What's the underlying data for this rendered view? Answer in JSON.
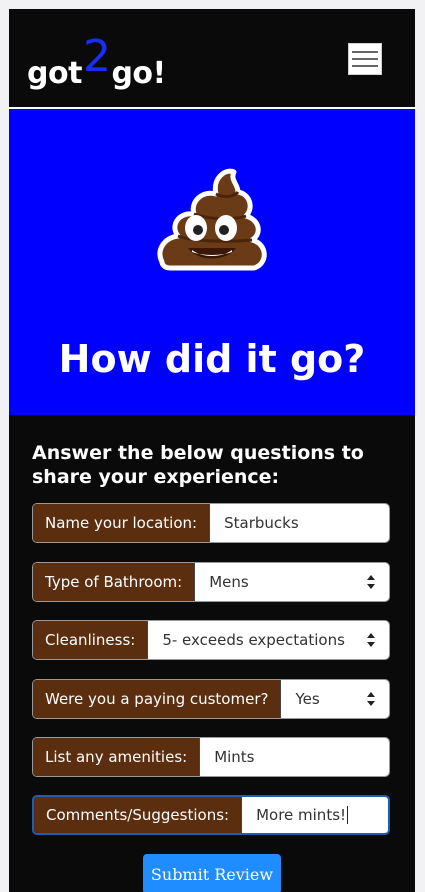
{
  "header": {
    "brand_prefix": "got",
    "brand_number": "2",
    "brand_suffix": "go!",
    "menu_icon": "hamburger-menu-icon"
  },
  "hero": {
    "emoji_icon": "pile-of-poo-emoji",
    "title": "How did it go?"
  },
  "form": {
    "intro": "Answer the below questions to share your experience:",
    "fields": [
      {
        "label": "Name your location:",
        "value": "Starbucks",
        "type": "text"
      },
      {
        "label": "Type of Bathroom:",
        "value": "Mens",
        "type": "select"
      },
      {
        "label": "Cleanliness:",
        "value": "5- exceeds expectations",
        "type": "select"
      },
      {
        "label": "Were you a paying customer?",
        "value": "Yes",
        "type": "select"
      },
      {
        "label": "List any amenities:",
        "value": "Mints",
        "type": "text"
      },
      {
        "label": "Comments/Suggestions:",
        "value": "More mints!",
        "type": "text"
      }
    ],
    "submit_label": "Submit Review"
  },
  "colors": {
    "background": "#0a0a0a",
    "hero_blue": "#0000ff",
    "label_brown": "#5a2e0f",
    "button_blue": "#1f8dff"
  }
}
